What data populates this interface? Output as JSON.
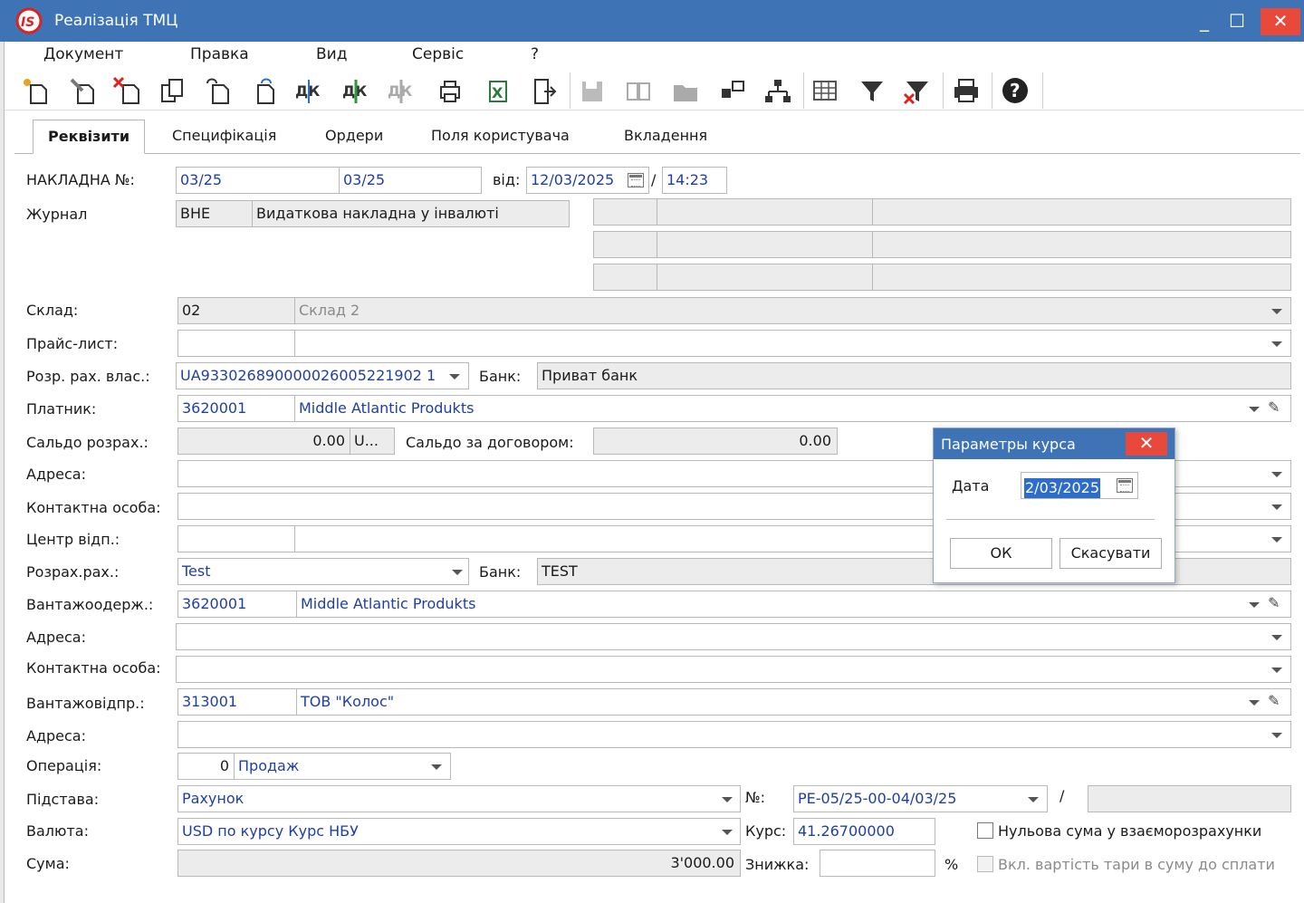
{
  "window": {
    "title": "Реалізація ТМЦ",
    "minimize": "_",
    "maximize": "☐",
    "close": "✕"
  },
  "menu": [
    "Документ",
    "Правка",
    "Вид",
    "Сервіс",
    "?"
  ],
  "tabs": [
    "Реквізити",
    "Специфікація",
    "Ордери",
    "Поля користувача",
    "Вкладення"
  ],
  "form": {
    "invoice_label": "НАКЛАДНА №:",
    "invoice_no1": "03/25",
    "invoice_no2": "03/25",
    "date_label": "від:",
    "date": "12/03/2025",
    "slash": "/",
    "time": "14:23",
    "journal_label": "Журнал",
    "journal_code": "ВНЕ",
    "journal_name": "Видаткова накладна у інвалюті",
    "warehouse_label": "Склад:",
    "warehouse_code": "02",
    "warehouse_name": "Склад 2",
    "pricelist_label": "Прайс-лист:",
    "own_account_label": "Розр. рах. влас.:",
    "own_account": "UA933026890000026005221902 1",
    "bank_label": "Банк:",
    "own_bank": "Приват банк",
    "payer_label": "Платник:",
    "payer_code": "3620001",
    "payer_name": "Middle Atlantic Produkts",
    "balance_label": "Сальдо розрах.:",
    "balance": "0.00",
    "balance_unit": "U...",
    "contract_balance_label": "Сальдо за договором:",
    "contract_balance": "0.00",
    "address_label": "Адреса:",
    "contact_label": "Контактна особа:",
    "center_label": "Центр відп.:",
    "settlement_label": "Розрах.рах.:",
    "settlement": "Test",
    "settlement_bank": "TEST",
    "consignee_label": "Вантажоодерж.:",
    "consignee_code": "3620001",
    "consignee_name": "Middle Atlantic Produkts",
    "shipper_label": "Вантажовідпр.:",
    "shipper_code": "313001",
    "shipper_name": "ТОВ \"Колос\"",
    "operation_label": "Операція:",
    "operation_code": "0",
    "operation_name": "Продаж",
    "basis_label": "Підстава:",
    "basis": "Рахунок",
    "number_label": "№:",
    "basis_number": "РЕ-05/25-00-04/03/25",
    "currency_label": "Валюта:",
    "currency": "USD по курсу Курс НБУ",
    "rate_label": "Курс:",
    "rate": "41.26700000",
    "zero_sum_label": "Нульова сума у взаєморозрахунки",
    "sum_label": "Сума:",
    "sum": "3'000.00",
    "discount_label": "Знижка:",
    "percent": "%",
    "tare_label": "Вкл. вартість тари в суму до сплати"
  },
  "dialog": {
    "title": "Параметры курса",
    "date_label": "Дата",
    "date_value": "2/03/2025",
    "ok": "ОК",
    "cancel": "Скасувати"
  }
}
